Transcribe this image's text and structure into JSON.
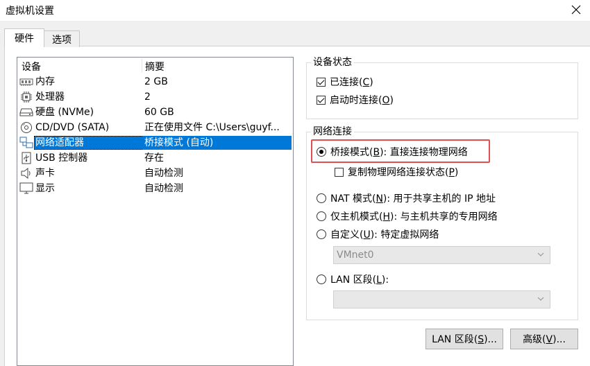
{
  "window": {
    "title": "虚拟机设置"
  },
  "tabs": [
    {
      "label": "硬件",
      "active": true
    },
    {
      "label": "选项",
      "active": false
    }
  ],
  "device_list": {
    "columns": [
      "设备",
      "摘要"
    ],
    "rows": [
      {
        "icon": "memory-icon",
        "name": "内存",
        "summary": "2 GB",
        "selected": false
      },
      {
        "icon": "processor-icon",
        "name": "处理器",
        "summary": "2",
        "selected": false
      },
      {
        "icon": "harddisk-icon",
        "name": "硬盘 (NVMe)",
        "summary": "60 GB",
        "selected": false
      },
      {
        "icon": "cd-dvd-icon",
        "name": "CD/DVD (SATA)",
        "summary": "正在使用文件 C:\\Users\\guyf...",
        "selected": false
      },
      {
        "icon": "network-adapter-icon",
        "name": "网络适配器",
        "summary": "桥接模式 (自动)",
        "selected": true
      },
      {
        "icon": "usb-icon",
        "name": "USB 控制器",
        "summary": "存在",
        "selected": false
      },
      {
        "icon": "sound-icon",
        "name": "声卡",
        "summary": "自动检测",
        "selected": false
      },
      {
        "icon": "display-icon",
        "name": "显示",
        "summary": "自动检测",
        "selected": false
      }
    ]
  },
  "device_status": {
    "title": "设备状态",
    "connected": {
      "text": "已连接(",
      "key": "C",
      "suffix": ")",
      "checked": true
    },
    "connect_on_start": {
      "text": "启动时连接(",
      "key": "O",
      "suffix": ")",
      "checked": true
    }
  },
  "network": {
    "title": "网络连接",
    "bridged": {
      "text": "桥接模式(",
      "key": "B",
      "suffix": "): 直接连接物理网络",
      "checked": true
    },
    "replicate": {
      "text": "复制物理网络连接状态(",
      "key": "P",
      "suffix": ")",
      "checked": false
    },
    "nat": {
      "text": "NAT 模式(",
      "key": "N",
      "suffix": "): 用于共享主机的 IP 地址",
      "checked": false
    },
    "host_only": {
      "text": "仅主机模式(",
      "key": "H",
      "suffix": "): 与主机共享的专用网络",
      "checked": false
    },
    "custom": {
      "text": "自定义(",
      "key": "U",
      "suffix": "): 特定虚拟网络",
      "checked": false
    },
    "custom_value": "VMnet0",
    "lan": {
      "text": "LAN 区段(",
      "key": "L",
      "suffix": "):",
      "checked": false
    },
    "lan_value": ""
  },
  "buttons": {
    "lan_segments": {
      "text": "LAN 区段(",
      "key": "S",
      "suffix": ")..."
    },
    "advanced": {
      "text": "高级(",
      "key": "V",
      "suffix": ")..."
    }
  },
  "colors": {
    "selection": "#0078d7",
    "highlight_border": "#e05050"
  }
}
